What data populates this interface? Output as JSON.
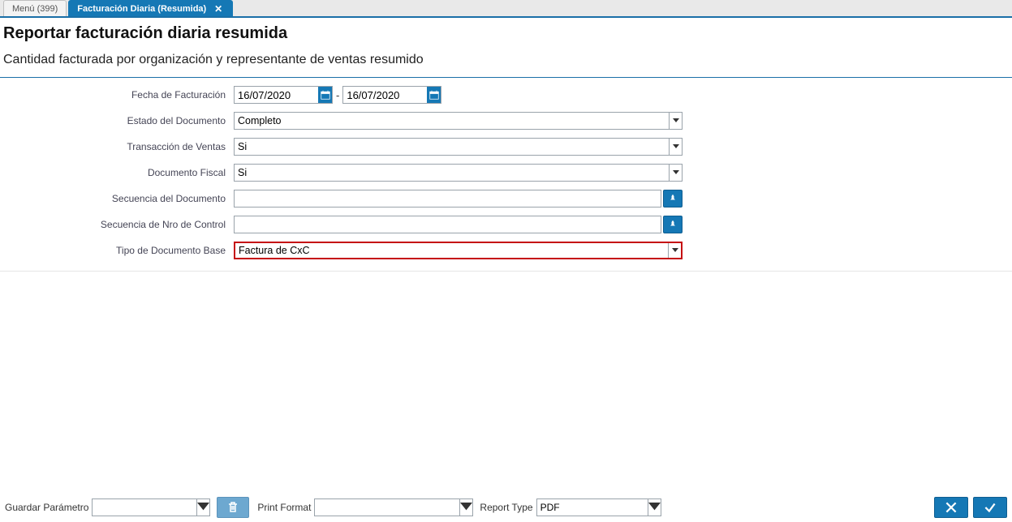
{
  "tabs": {
    "menu": "Menú (399)",
    "active": "Facturación Diaria (Resumida)"
  },
  "header": {
    "title": "Reportar facturación diaria resumida",
    "subtitle": "Cantidad facturada por organización y representante de ventas resumido"
  },
  "form": {
    "labels": {
      "fecha": "Fecha de Facturación",
      "estado": "Estado del Documento",
      "transaccion": "Transacción de Ventas",
      "fiscal": "Documento Fiscal",
      "secuencia_doc": "Secuencia del Documento",
      "secuencia_ctrl": "Secuencia de Nro de Control",
      "tipo_doc": "Tipo de Documento Base"
    },
    "values": {
      "fecha_from": "16/07/2020",
      "fecha_to": "16/07/2020",
      "estado": "Completo",
      "transaccion": "Si",
      "fiscal": "Si",
      "secuencia_doc": "",
      "secuencia_ctrl": "",
      "tipo_doc": "Factura de CxC"
    }
  },
  "footer": {
    "guardar_label": "Guardar Parámetro",
    "guardar_value": "",
    "print_format_label": "Print Format",
    "print_format_value": "",
    "report_type_label": "Report Type",
    "report_type_value": "PDF"
  }
}
